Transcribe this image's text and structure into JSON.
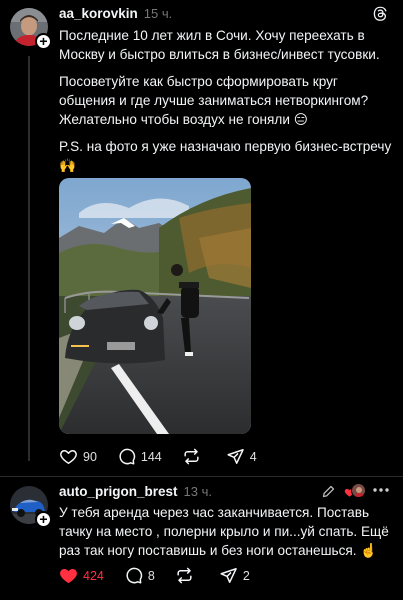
{
  "post1": {
    "username": "aa_korovkin",
    "time": "15 ч.",
    "paragraphs": [
      "Последние 10 лет жил в Сочи. Хочу переехать в Москву и быстро влиться в бизнес/инвест тусовки.",
      "Посоветуйте как быстро сформировать круг общения и где лучше заниматься нетворкингом? Желательно чтобы воздух не гоняли 😑",
      "P.S. на фото я уже назначаю первую бизнес-встречу 🙌"
    ],
    "likes": "90",
    "comments": "144",
    "reposts": "",
    "shares": "4",
    "icons": [
      "threads-logo-icon",
      "heart-icon",
      "comment-icon",
      "repost-icon",
      "share-icon"
    ]
  },
  "post2": {
    "username": "auto_prigon_brest",
    "time": "13 ч.",
    "text": "У тебя аренда через час заканчивается. Поставь тачку на место , полерни крыло и пи...уй спать. Ещё раз так ногу поставишь и без ноги останешься. ☝️",
    "likes": "424",
    "comments": "8",
    "reposts": "",
    "shares": "2",
    "accent_like_color": "#ff3040",
    "icons": [
      "pencil-icon",
      "heart-icon",
      "more-icon",
      "comment-icon",
      "repost-icon",
      "share-icon"
    ]
  }
}
